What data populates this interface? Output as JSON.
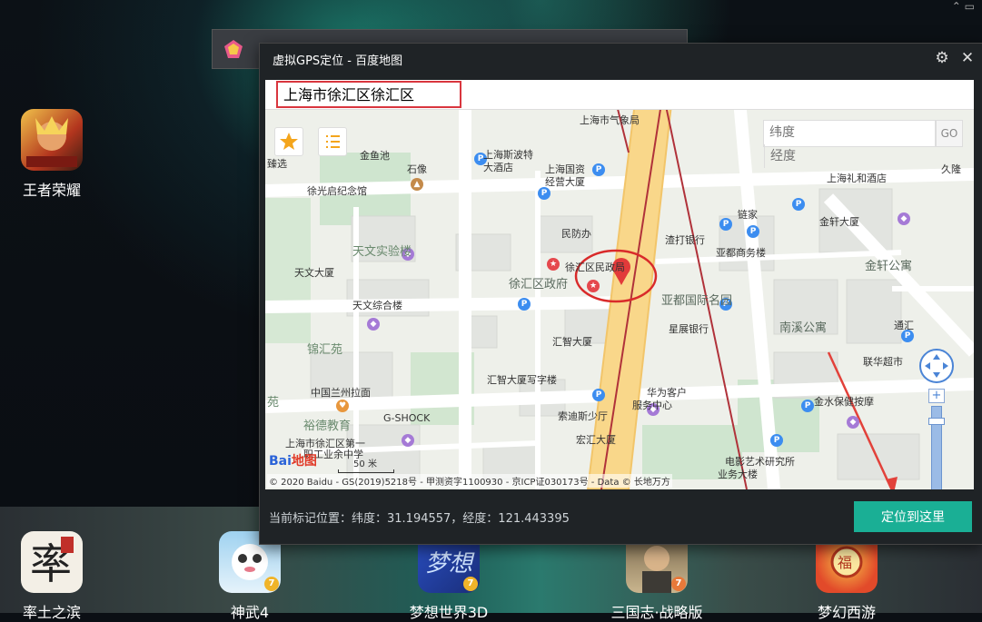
{
  "desktop": {
    "apps_left": [
      {
        "label": "王者荣耀"
      }
    ],
    "dock_apps": [
      {
        "label": "率土之滨"
      },
      {
        "label": "神武4"
      },
      {
        "label": "梦想世界3D"
      },
      {
        "label": "三国志·战略版"
      },
      {
        "label": "梦幻西游"
      }
    ]
  },
  "gps_window": {
    "title": "虚拟GPS定位 - 百度地图",
    "search_value": "上海市徐汇区徐汇区",
    "lat_placeholder": "纬度",
    "lng_placeholder": "经度",
    "go_label": "GO",
    "status": "当前标记位置：纬度：31.194557，经度：121.443395",
    "locate_button": "定位到这里",
    "copyright": "© 2020 Baidu - GS(2019)5218号 - 甲测资字1100930 - 京ICP证030173号 - Data © 长地万方",
    "scale_label": "50 米",
    "logo_text_baidu": "Bai",
    "logo_text_map": "地图"
  },
  "map_labels": [
    {
      "text": "上海市气象局"
    },
    {
      "text": "上海斯波特"
    },
    {
      "text": "大酒店"
    },
    {
      "text": "上海国资"
    },
    {
      "text": "经营大厦"
    },
    {
      "text": "金鱼池"
    },
    {
      "text": "石像"
    },
    {
      "text": "徐光启纪念馆"
    },
    {
      "text": "民防办"
    },
    {
      "text": "天文实验楼"
    },
    {
      "text": "天文大厦"
    },
    {
      "text": "天文综合楼"
    },
    {
      "text": "徐汇区民政局"
    },
    {
      "text": "徐汇区政府"
    },
    {
      "text": "汇智大厦"
    },
    {
      "text": "锦汇苑"
    },
    {
      "text": "中国兰州拉面"
    },
    {
      "text": "汇智大厦写字楼"
    },
    {
      "text": "G-SHOCK"
    },
    {
      "text": "裕德教育"
    },
    {
      "text": "上海市徐汇区第一"
    },
    {
      "text": "职工业余中学"
    },
    {
      "text": "索迪斯少厅"
    },
    {
      "text": "宏汇大厦"
    },
    {
      "text": "华为客户"
    },
    {
      "text": "服务中心"
    },
    {
      "text": "星展银行"
    },
    {
      "text": "亚都国际名园"
    },
    {
      "text": "渣打银行"
    },
    {
      "text": "亚都商务楼"
    },
    {
      "text": "链家"
    },
    {
      "text": "金轩大厦"
    },
    {
      "text": "金轩公寓"
    },
    {
      "text": "上海礼和酒店"
    },
    {
      "text": "南溪公寓"
    },
    {
      "text": "联华超市"
    },
    {
      "text": "金水保健按摩"
    },
    {
      "text": "电影艺术研究所"
    },
    {
      "text": "业务大楼"
    },
    {
      "text": "通汇"
    },
    {
      "text": "久隆"
    },
    {
      "text": "苑"
    },
    {
      "text": "臻选"
    }
  ]
}
